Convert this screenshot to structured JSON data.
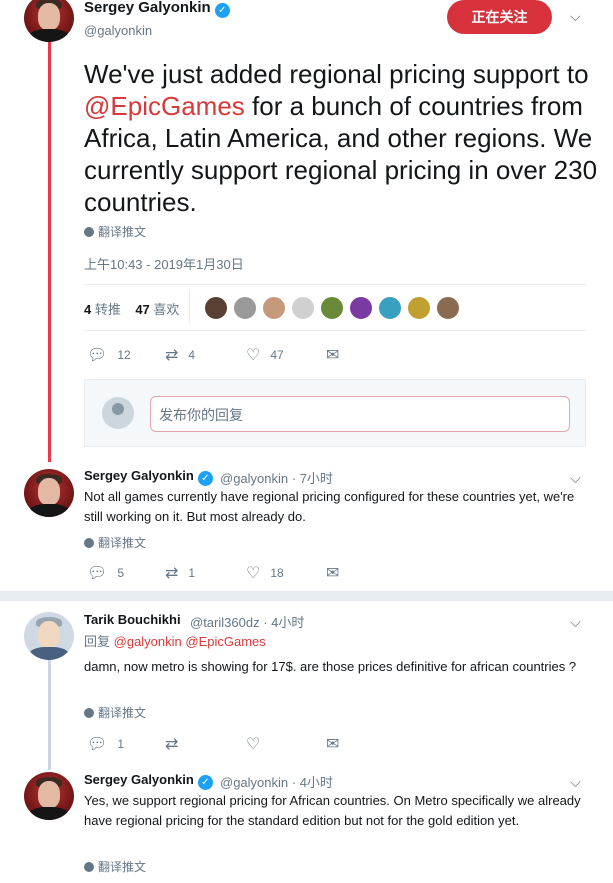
{
  "main_tweet": {
    "name": "Sergey Galyonkin",
    "handle": "@galyonkin",
    "follow_label": "正在关注",
    "text_before": "We've just added regional pricing support to ",
    "mention": "@EpicGames",
    "text_after": " for a bunch of countries from Africa, Latin America, and other regions. We currently support regional pricing in over 230 countries.",
    "translate": "翻译推文",
    "timestamp": "上午10:43 - 2019年1月30日",
    "retweets_count": "4",
    "retweets_label": "转推",
    "likes_count": "47",
    "likes_label": "喜欢",
    "actions": {
      "replies": "12",
      "retweets": "4",
      "likes": "47"
    }
  },
  "reply_box": {
    "placeholder": "发布你的回复"
  },
  "replies": [
    {
      "name": "Sergey Galyonkin",
      "handle": "@galyonkin",
      "time": "· 7小时",
      "text": "Not all games currently have regional pricing configured for these countries yet, we're still working on it. But most already do.",
      "translate": "翻译推文",
      "actions": {
        "replies": "5",
        "retweets": "1",
        "likes": "18"
      }
    },
    {
      "name": "Tarik Bouchikhi",
      "handle": "@taril360dz",
      "time": "· 4小时",
      "reply_prefix": "回复",
      "reply_to": "@galyonkin @EpicGames",
      "text": "damn, now metro is showing for 17$. are those prices definitive for african countries ?",
      "translate": "翻译推文",
      "actions": {
        "replies": "1",
        "retweets": "",
        "likes": ""
      }
    },
    {
      "name": "Sergey Galyonkin",
      "handle": "@galyonkin",
      "time": "· 4小时",
      "text": "Yes, we support regional pricing for African countries. On Metro specifically we already have regional pricing for the standard edition but not for the gold edition yet.",
      "translate": "翻译推文"
    }
  ],
  "icons": {
    "reply": "reply-icon",
    "retweet": "retweet-icon",
    "like": "heart-icon",
    "dm": "envelope-icon",
    "verified": "verified-badge-icon",
    "chevron": "chevron-down-icon",
    "globe": "globe-icon"
  },
  "colors": {
    "accent": "#d7323c",
    "mention": "#d63a3a",
    "thread_line": "#e83a4b",
    "muted": "#657786"
  }
}
